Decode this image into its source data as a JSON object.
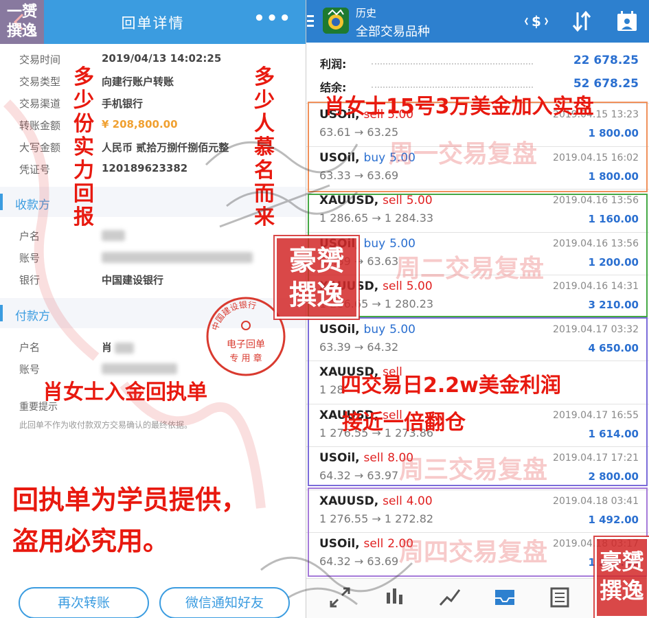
{
  "left": {
    "header": {
      "title": "回单详情",
      "more": "•••"
    },
    "details": [
      {
        "k": "交易时间",
        "v": "2019/04/13 14:02:25"
      },
      {
        "k": "交易类型",
        "v": "向建行账户转账"
      },
      {
        "k": "交易渠道",
        "v": "手机银行"
      },
      {
        "k": "转账金额",
        "v": "¥ 208,800.00"
      },
      {
        "k": "大写金额",
        "v": "人民币 贰拾万捌仟捌佰元整"
      },
      {
        "k": "凭证号",
        "v": "120189623382"
      }
    ],
    "payee": {
      "section": "收款方",
      "name_label": "户名",
      "account_label": "账号",
      "bank_label": "银行",
      "bank": "中国建设银行"
    },
    "payer": {
      "section": "付款方",
      "name_label": "户名",
      "name_visible": "肖",
      "account_label": "账号"
    },
    "tip": {
      "title": "重要提示",
      "text": "此回单不作为收付款双方交易确认的最终依据。"
    },
    "stamp": {
      "top": "中国建设银行",
      "line1": "电子回单",
      "line2": "专 用 章"
    },
    "buttons": {
      "again": "再次转账",
      "wechat": "微信通知好友"
    },
    "overlay": {
      "v1": "多少份实力回报",
      "v2": "多少人慕名而来",
      "receipt": "肖女士入金回执单",
      "note1": "回执单为学员提供，",
      "note2": "盗用必究用。"
    }
  },
  "right": {
    "header": {
      "title": "历史",
      "subtitle": "全部交易品种"
    },
    "summary": [
      {
        "k": "利润:",
        "v": "22 678.25"
      },
      {
        "k": "结余:",
        "v": "52 678.25"
      }
    ],
    "trades": [
      {
        "symbol": "USOil,",
        "side": "sell",
        "lots": "5.00",
        "prices": "63.61 → 63.25",
        "time": "2019.04.15 13:23",
        "profit": "1 800.00"
      },
      {
        "symbol": "USOil,",
        "side": "buy",
        "lots": "5.00",
        "prices": "63.33 → 63.69",
        "time": "2019.04.15 16:02",
        "profit": "1 800.00"
      },
      {
        "symbol": "XAUUSD,",
        "side": "sell",
        "lots": "5.00",
        "prices": "1 286.65 → 1 284.33",
        "time": "2019.04.16 13:56",
        "profit": "1 160.00"
      },
      {
        "symbol": "USOil,",
        "side": "buy",
        "lots": "5.00",
        "prices": "63.39 → 63.63",
        "time": "2019.04.16 13:56",
        "profit": "1 200.00"
      },
      {
        "symbol": "XAUUSD,",
        "side": "sell",
        "lots": "5.00",
        "prices": "1 286.65 → 1 280.23",
        "time": "2019.04.16 14:31",
        "profit": "3 210.00"
      },
      {
        "symbol": "USOil,",
        "side": "buy",
        "lots": "5.00",
        "prices": "63.39 → 64.32",
        "time": "2019.04.17 03:32",
        "profit": "4 650.00"
      },
      {
        "symbol": "XAUUSD,",
        "side": "sell",
        "lots": "",
        "prices": "1 28",
        "time": "",
        "profit": ""
      },
      {
        "symbol": "XAUUSD,",
        "side": "sell",
        "lots": "",
        "prices": "1 276.55 → 1 273.86",
        "time": "2019.04.17 16:55",
        "profit": "1 614.00"
      },
      {
        "symbol": "USOil,",
        "side": "sell",
        "lots": "8.00",
        "prices": "64.32 → 63.97",
        "time": "2019.04.17 17:21",
        "profit": "2 800.00"
      },
      {
        "symbol": "XAUUSD,",
        "side": "sell",
        "lots": "4.00",
        "prices": "1 276.55 → 1 272.82",
        "time": "2019.04.18 03:41",
        "profit": "1 492.00"
      },
      {
        "symbol": "USOil,",
        "side": "sell",
        "lots": "2.00",
        "prices": "64.32 → 63.69",
        "time": "2019.04.18 03:17",
        "profit": "1 250.00"
      }
    ],
    "watermarks": {
      "mon": "周一交易复盘",
      "tue": "周二交易复盘",
      "wed": "周三交易复盘",
      "thu": "周四交易复盘"
    },
    "overlay": {
      "top": "肖女士15号3万美金加入实盘",
      "mid1": "四交易日2.2w美金利润",
      "mid2": "接近一倍翻仓"
    }
  },
  "seals": {
    "mid": "豪赟撰逸",
    "bot": "豪赟撰逸",
    "tl": "一赟撰逸"
  },
  "colors": {
    "left_header": "#3b9ce0",
    "right_header": "#2d80cf",
    "overlay_red": "#e8190f",
    "sell": "#e02020",
    "buy": "#2a6fd0"
  }
}
